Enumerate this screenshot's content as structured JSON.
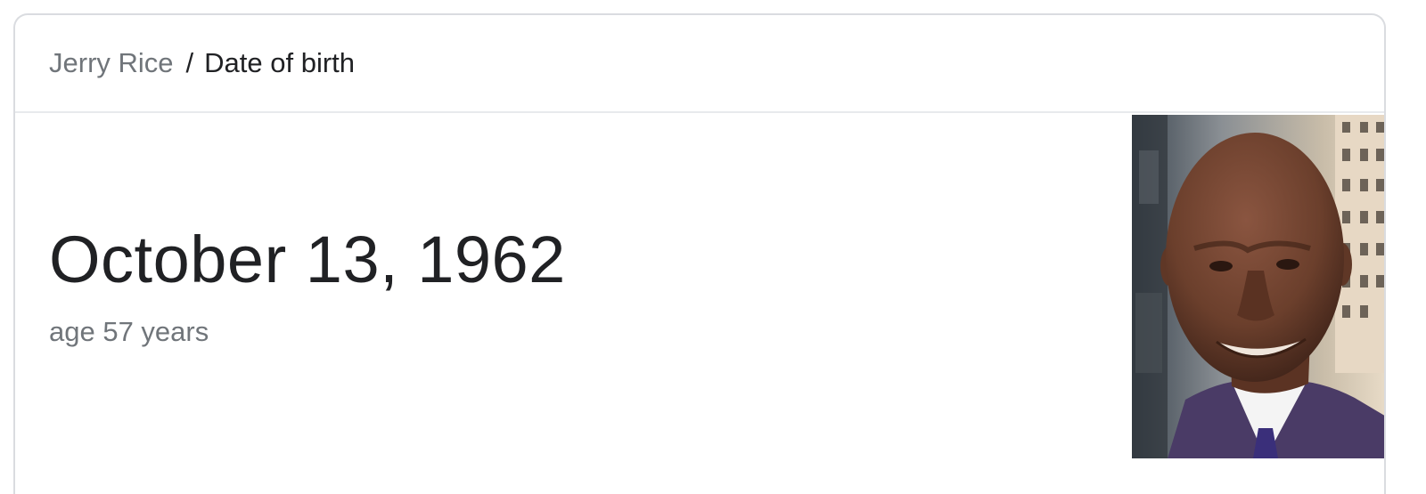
{
  "breadcrumb": {
    "entity": "Jerry Rice",
    "separator": "/",
    "attribute": "Date of birth"
  },
  "answer": {
    "value": "October 13, 1962",
    "subtext": "age 57 years"
  },
  "photo": {
    "alt": "Jerry Rice",
    "colors": {
      "background": "#b9b2a6",
      "building": "#e7d8c4",
      "skin": "#6b3f2c",
      "suit": "#4a3b66",
      "shirt": "#f4f4f4",
      "tie": "#3a2f7a"
    }
  },
  "theme": {
    "border": "#dadce0",
    "text_primary": "#202124",
    "text_secondary": "#70757a"
  }
}
